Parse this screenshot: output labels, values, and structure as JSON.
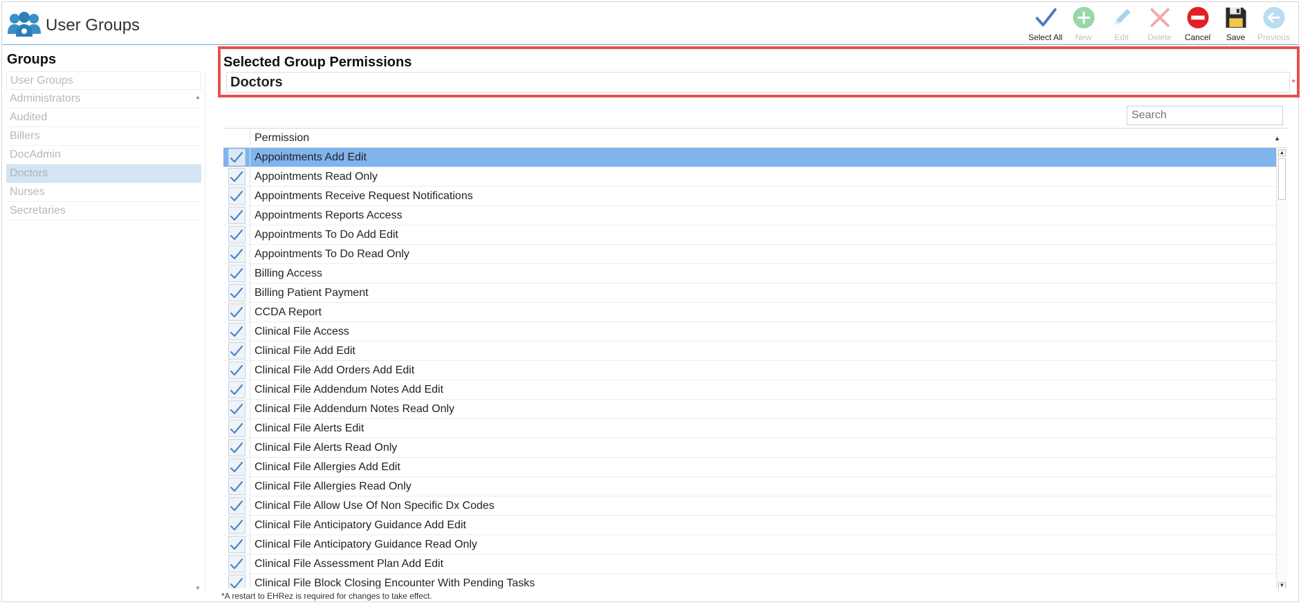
{
  "header": {
    "title": "User Groups",
    "toolbar": [
      {
        "label": "Select All",
        "icon": "checkmark-icon",
        "enabled": true,
        "color": "#4a7bbf"
      },
      {
        "label": "New",
        "icon": "plus-circle-icon",
        "enabled": false,
        "color": "#9bd6a6"
      },
      {
        "label": "Edit",
        "icon": "pencil-icon",
        "enabled": false,
        "color": "#aad1ea"
      },
      {
        "label": "Delete",
        "icon": "x-icon",
        "enabled": false,
        "color": "#f4a8a8"
      },
      {
        "label": "Cancel",
        "icon": "no-entry-icon",
        "enabled": true,
        "color": "#e31e24"
      },
      {
        "label": "Save",
        "icon": "floppy-disk-icon",
        "enabled": true,
        "color": "#2b2b2b"
      },
      {
        "label": "Previous",
        "icon": "arrow-left-circle-icon",
        "enabled": false,
        "color": "#b9dcf2"
      }
    ]
  },
  "groups": {
    "heading": "Groups",
    "column_header": "User Groups",
    "items": [
      "Administrators",
      "Audited",
      "Billers",
      "DocAdmin",
      "Doctors",
      "Nurses",
      "Secretaries"
    ],
    "selected": "Doctors"
  },
  "permissions": {
    "heading": "Selected Group Permissions",
    "group_name": "Doctors",
    "required_marker": "*",
    "search_placeholder": "Search",
    "column_header": "Permission",
    "rows": [
      {
        "label": "Appointments Add Edit",
        "checked": true,
        "selected": true
      },
      {
        "label": "Appointments Read Only",
        "checked": true
      },
      {
        "label": "Appointments Receive Request Notifications",
        "checked": true
      },
      {
        "label": "Appointments Reports Access",
        "checked": true
      },
      {
        "label": "Appointments To Do Add Edit",
        "checked": true
      },
      {
        "label": "Appointments To Do Read Only",
        "checked": true
      },
      {
        "label": "Billing Access",
        "checked": true
      },
      {
        "label": "Billing Patient Payment",
        "checked": true
      },
      {
        "label": "CCDA Report",
        "checked": true
      },
      {
        "label": "Clinical File Access",
        "checked": true
      },
      {
        "label": "Clinical File Add Edit",
        "checked": true
      },
      {
        "label": "Clinical File Add Orders Add Edit",
        "checked": true
      },
      {
        "label": "Clinical File Addendum Notes Add Edit",
        "checked": true
      },
      {
        "label": "Clinical File Addendum Notes Read Only",
        "checked": true
      },
      {
        "label": "Clinical File Alerts Edit",
        "checked": true
      },
      {
        "label": "Clinical File Alerts Read Only",
        "checked": true
      },
      {
        "label": "Clinical File Allergies Add Edit",
        "checked": true
      },
      {
        "label": "Clinical File Allergies Read Only",
        "checked": true
      },
      {
        "label": "Clinical File Allow Use Of Non Specific Dx Codes",
        "checked": true
      },
      {
        "label": "Clinical File Anticipatory Guidance Add Edit",
        "checked": true
      },
      {
        "label": "Clinical File Anticipatory Guidance Read Only",
        "checked": true
      },
      {
        "label": "Clinical File Assessment Plan Add Edit",
        "checked": true
      },
      {
        "label": "Clinical File Block Closing Encounter With Pending Tasks",
        "checked": true
      }
    ],
    "footer_note": "*A restart to EHRez is required for changes to take effect."
  },
  "colors": {
    "accent": "#80b4ed",
    "highlight_border": "#e3524c",
    "check": "#4a86c8"
  }
}
